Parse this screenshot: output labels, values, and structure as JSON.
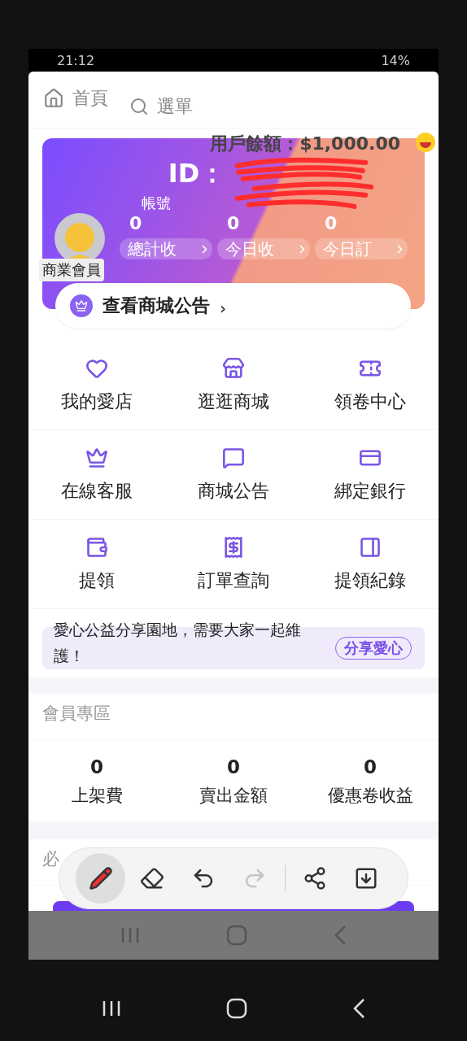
{
  "status_bar": {
    "time": "21:12",
    "battery": "14%"
  },
  "header": {
    "home": "首頁",
    "menu": "選單"
  },
  "account_card": {
    "balance": "用戶餘額：$1,000.00",
    "id_label": "ID：",
    "account_label": "帳號",
    "badge": "商業會員",
    "stats": [
      {
        "value": "0",
        "label": "總計收"
      },
      {
        "value": "0",
        "label": "今日收"
      },
      {
        "value": "0",
        "label": "今日訂"
      }
    ]
  },
  "notice": {
    "label": "查看商城公告",
    "arrow": "›"
  },
  "menu_items": [
    {
      "label": "我的愛店"
    },
    {
      "label": "逛逛商城"
    },
    {
      "label": "領卷中心"
    },
    {
      "label": "在線客服"
    },
    {
      "label": "商城公告"
    },
    {
      "label": "綁定銀行"
    },
    {
      "label": "提領"
    },
    {
      "label": "訂單查詢"
    },
    {
      "label": "提領紀錄"
    }
  ],
  "charity": {
    "text": "愛心公益分享園地，需要大家一起維護！",
    "button": "分享愛心"
  },
  "member_section": {
    "title": "會員專區",
    "stats": [
      {
        "value": "0",
        "label": "上架費"
      },
      {
        "value": "0",
        "label": "賣出金額"
      },
      {
        "value": "0",
        "label": "優惠卷收益"
      }
    ]
  },
  "next_section": {
    "title": "必"
  },
  "edit_toolbar": {
    "tools": [
      {
        "selected": true,
        "disabled": false
      },
      {
        "selected": false,
        "disabled": false
      },
      {
        "selected": false,
        "disabled": false
      },
      {
        "selected": false,
        "disabled": true
      },
      {
        "selected": false,
        "disabled": false
      },
      {
        "selected": false,
        "disabled": false
      }
    ]
  }
}
